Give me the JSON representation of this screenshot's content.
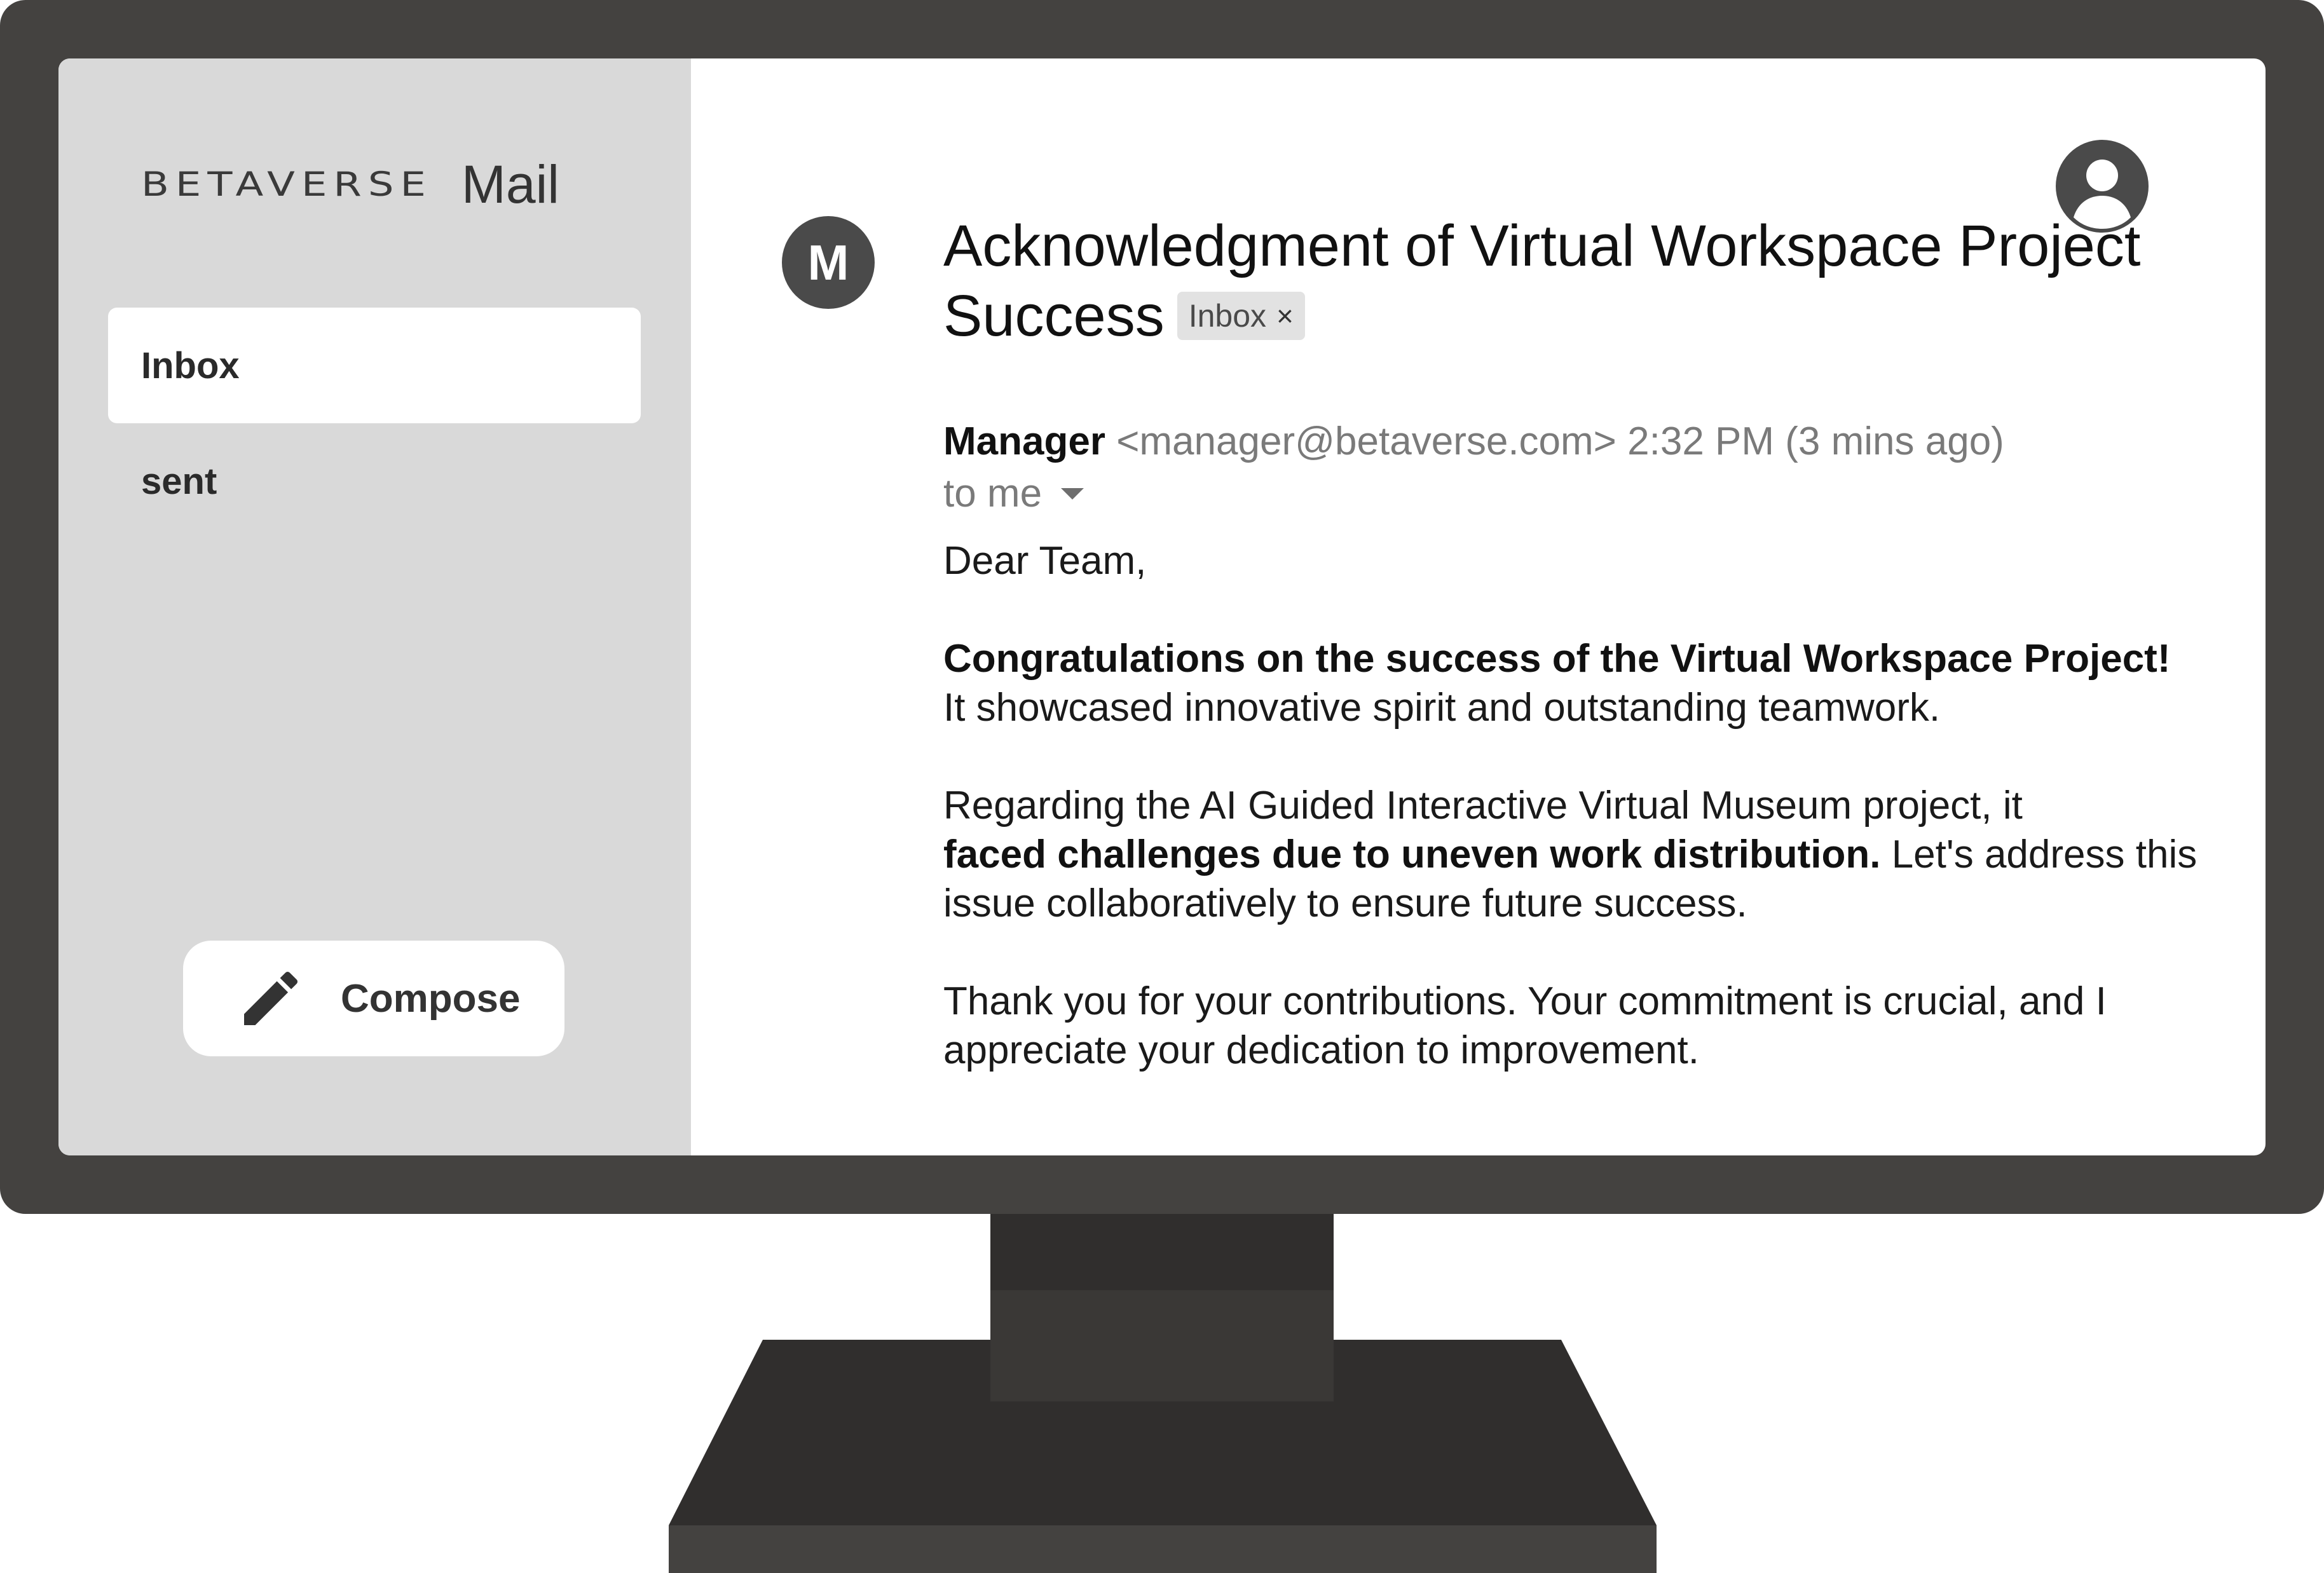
{
  "brand": {
    "logo": "BETAVERSE",
    "app_name": "Mail"
  },
  "sidebar": {
    "items": [
      {
        "label": "Inbox",
        "active": true
      },
      {
        "label": "sent",
        "active": false
      }
    ],
    "compose": {
      "label": "Compose",
      "icon": "pencil-icon"
    }
  },
  "header": {
    "user_icon": "account-circle-icon"
  },
  "email": {
    "avatar_letter": "M",
    "subject": "Acknowledgment of Virtual Workspace Project Success",
    "label_chip": {
      "text": "Inbox",
      "close": "×"
    },
    "sender_name": "Manager",
    "sender_email": "<manager@betaverse.com>",
    "time": "2:32 PM (3 mins ago)",
    "recipient": "to me",
    "body": {
      "greeting": "Dear Team,",
      "p1_bold": "Congratulations on the success of the Virtual Workspace Project!",
      "p1_rest": "It showcased innovative spirit and outstanding teamwork.",
      "p2_start": "Regarding the AI Guided Interactive Virtual Museum project, it",
      "p2_bold": "faced challenges due to uneven work distribution.",
      "p2_rest": "Let's address this issue collaboratively to ensure future success.",
      "p3": "Thank you for your contributions. Your commitment is crucial, and I appreciate your dedication to improvement."
    }
  },
  "colors": {
    "bezel": "#444240",
    "sidebar_bg": "#d9d9d9",
    "avatar_bg": "#4a4a4a",
    "chip_bg": "#e2e2e2",
    "muted_text": "#7a7a7a"
  }
}
